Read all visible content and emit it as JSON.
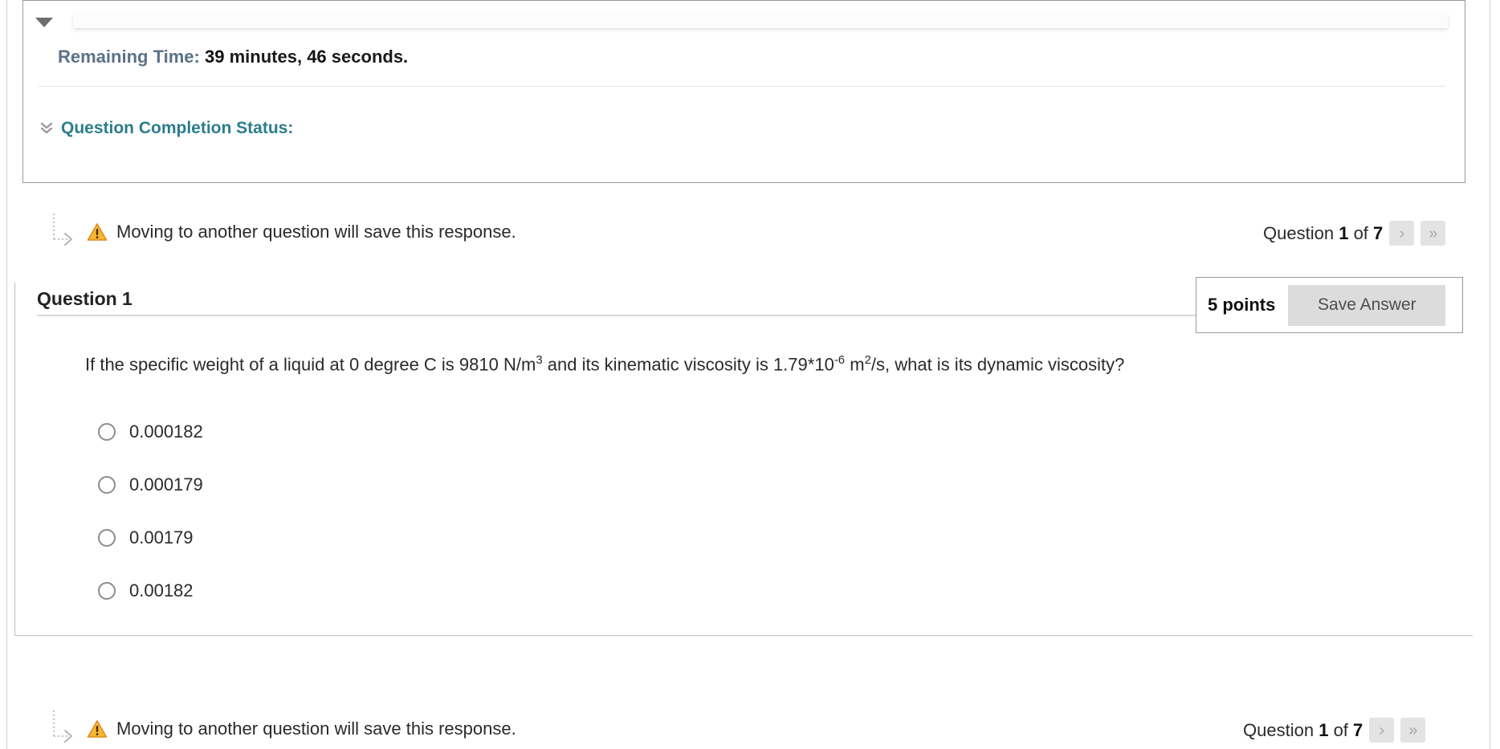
{
  "status_panel": {
    "collapse_icon": "caret-down-icon",
    "remaining_time_label": "Remaining Time:",
    "remaining_time_minutes": "39",
    "remaining_time_minutes_unit": "minutes,",
    "remaining_time_seconds": "46",
    "remaining_time_seconds_unit": "seconds.",
    "completion_status_label": "Question Completion Status:",
    "completion_status_icon": "chevron-double-down-icon"
  },
  "warning": {
    "icon": "warning-triangle-icon",
    "text": "Moving to another question will save this response.",
    "connector_icon": "dotted-arrow-icon"
  },
  "question_nav": {
    "prefix": "Question",
    "current": "1",
    "middle": "of",
    "total": "7",
    "next_label": "›",
    "last_label": "»",
    "next_icon": "chevron-right-icon",
    "last_icon": "chevron-double-right-icon"
  },
  "question": {
    "title": "Question 1",
    "points": "5 points",
    "save_button": "Save Answer",
    "text_part1": "If the specific weight of a liquid at 0 degree C is 9810 N/m",
    "text_sup1": "3",
    "text_part2": " and its kinematic viscosity is 1.79*10",
    "text_sup2": "-6",
    "text_part3": " m",
    "text_sup3": "2",
    "text_part4": "/s, what is its dynamic viscosity?",
    "options": [
      {
        "label": "0.000182",
        "selected": false
      },
      {
        "label": "0.000179",
        "selected": false
      },
      {
        "label": "0.00179",
        "selected": false
      },
      {
        "label": "0.00182",
        "selected": false
      }
    ]
  },
  "colors": {
    "teal": "#2b7d8c",
    "time_label": "#5b7287",
    "warning_orange": "#f5a623",
    "button_gray": "#dcdcdc"
  }
}
